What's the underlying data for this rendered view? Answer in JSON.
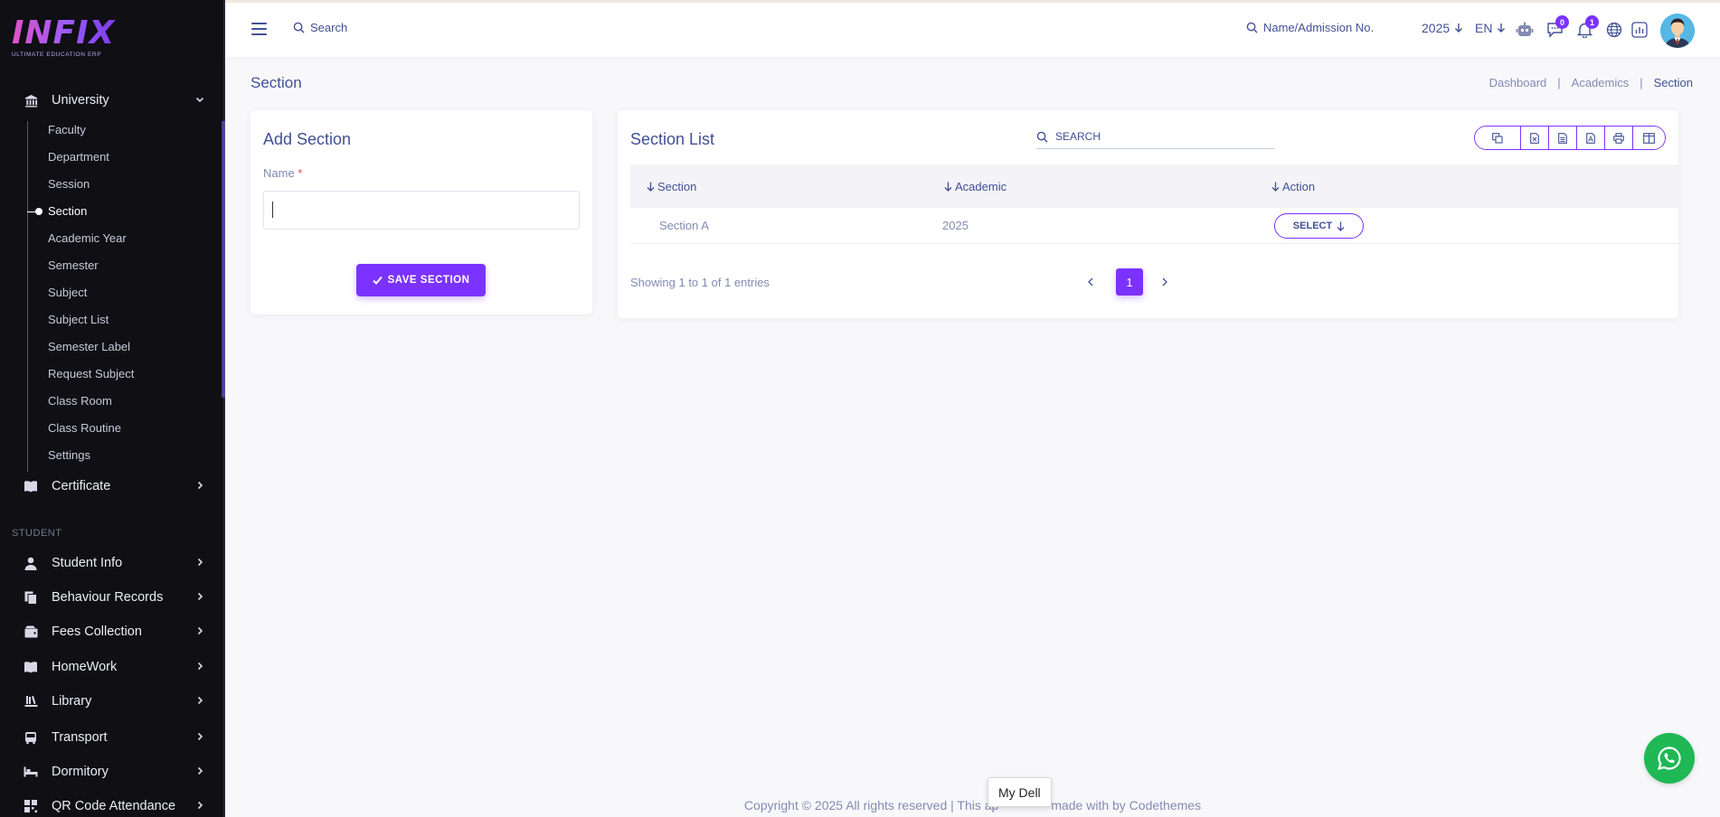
{
  "brand": {
    "logo_text": "INFIX",
    "logo_subtitle": "ULTIMATE EDUCATION ERP",
    "accent": "#7c32ff"
  },
  "sidebar": {
    "university": {
      "label": "University",
      "icon": "university-icon"
    },
    "submenu": [
      {
        "label": "Faculty"
      },
      {
        "label": "Department"
      },
      {
        "label": "Session"
      },
      {
        "label": "Section",
        "active": true
      },
      {
        "label": "Academic Year"
      },
      {
        "label": "Semester"
      },
      {
        "label": "Subject"
      },
      {
        "label": "Subject List"
      },
      {
        "label": "Semester Label"
      },
      {
        "label": "Request Subject"
      },
      {
        "label": "Class Room"
      },
      {
        "label": "Class Routine"
      },
      {
        "label": "Settings"
      }
    ],
    "certificate": {
      "label": "Certificate",
      "icon": "book-open-icon"
    },
    "student_heading": "STUDENT",
    "student_items": [
      {
        "label": "Student Info",
        "icon": "user-icon"
      },
      {
        "label": "Behaviour Records",
        "icon": "copy-icon"
      },
      {
        "label": "Fees Collection",
        "icon": "wallet-icon"
      },
      {
        "label": "HomeWork",
        "icon": "book-icon"
      },
      {
        "label": "Library",
        "icon": "library-icon"
      },
      {
        "label": "Transport",
        "icon": "bus-icon"
      },
      {
        "label": "Dormitory",
        "icon": "bed-icon"
      },
      {
        "label": "QR Code Attendance",
        "icon": "qr-code-icon"
      }
    ]
  },
  "header": {
    "search_placeholder": "Search",
    "admission_search_placeholder": "Name/Admission No.",
    "year": "2025",
    "language": "EN",
    "chat_badge": "0",
    "notification_badge": "1"
  },
  "page": {
    "title": "Section",
    "breadcrumb": [
      "Dashboard",
      "Academics",
      "Section"
    ]
  },
  "add_section": {
    "title": "Add Section",
    "name_label": "Name",
    "required_mark": "*",
    "name_value": "",
    "save_label": "SAVE SECTION"
  },
  "section_list": {
    "title": "Section List",
    "search_placeholder": "SEARCH",
    "export_buttons": [
      "copy-icon",
      "excel-icon",
      "csv-icon",
      "pdf-icon",
      "print-icon",
      "columns-icon"
    ],
    "columns": [
      "Section",
      "Academic",
      "Action"
    ],
    "rows": [
      {
        "section": "Section A",
        "academic": "2025",
        "action": "SELECT"
      }
    ],
    "showing": "Showing 1 to 1 of 1 entries",
    "current_page": "1"
  },
  "footer": {
    "copyright_left": "Copyright © 2025 All rights reserved | This ap",
    "copyright_right": "made with by Codethemes",
    "tooltip": "My Dell"
  }
}
